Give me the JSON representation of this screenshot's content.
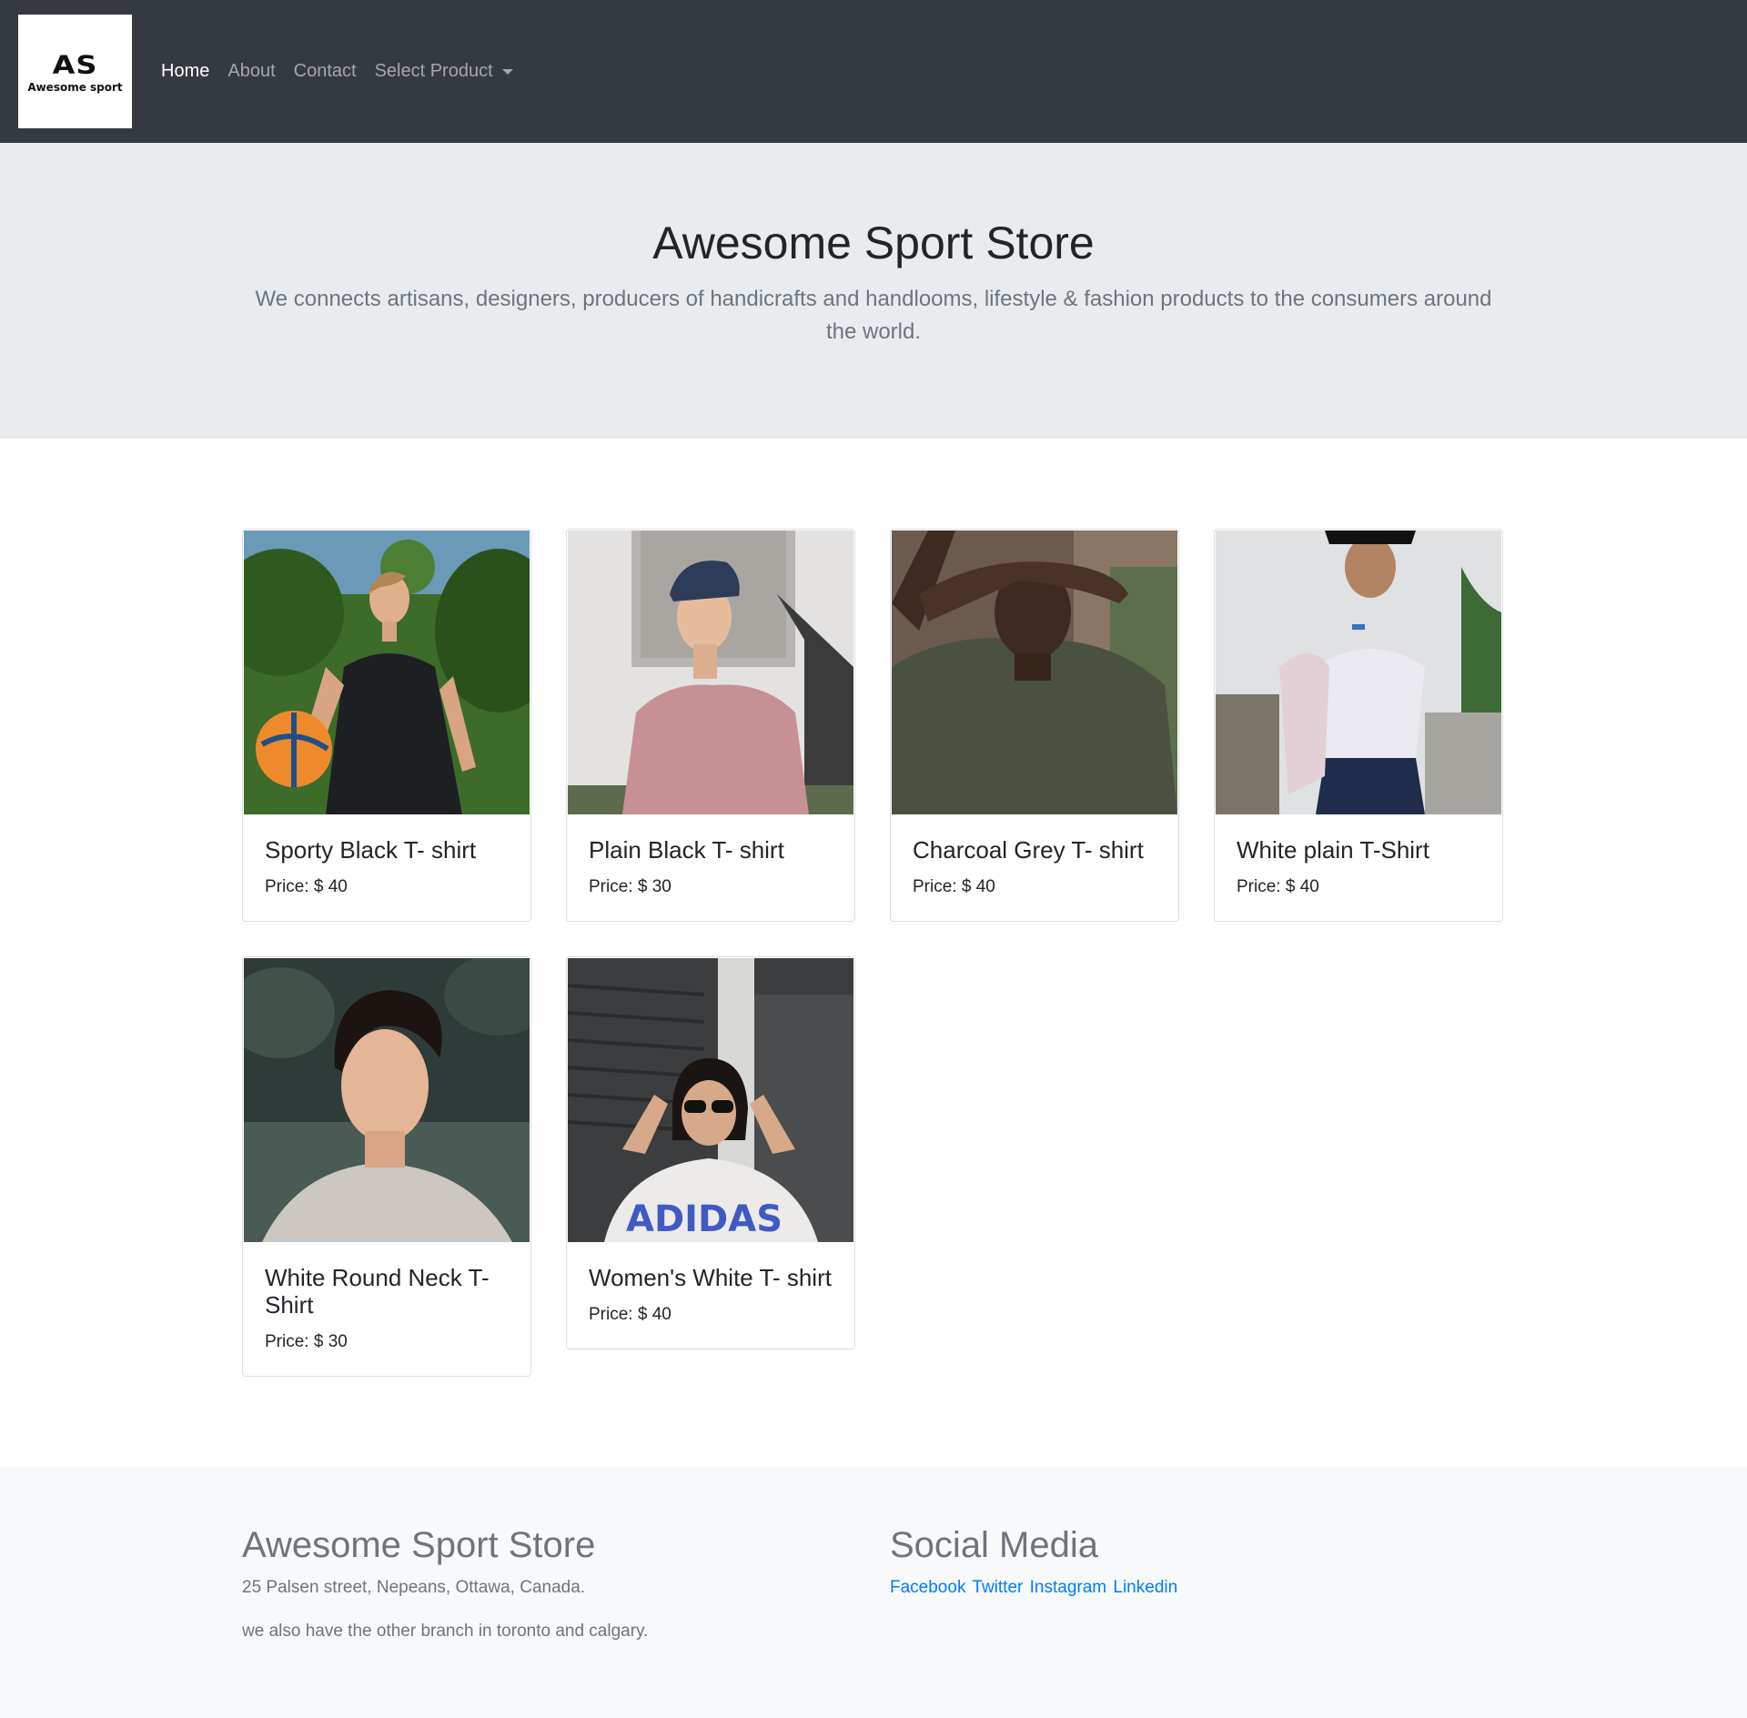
{
  "brand": {
    "mark": "AS",
    "name": "Awesome sport"
  },
  "nav": {
    "home": "Home",
    "about": "About",
    "contact": "Contact",
    "select_product": "Select Product"
  },
  "hero": {
    "title": "Awesome Sport Store",
    "lead": "We connects artisans, designers, producers of handicrafts and handlooms, lifestyle & fashion products to the consumers around the world."
  },
  "products": [
    {
      "title": "Sporty Black T- shirt",
      "price": "Price: $ 40"
    },
    {
      "title": "Plain Black T- shirt",
      "price": "Price: $ 30"
    },
    {
      "title": "Charcoal Grey T- shirt",
      "price": "Price: $ 40"
    },
    {
      "title": "White plain T-Shirt",
      "price": "Price: $ 40"
    },
    {
      "title": "White Round Neck T-Shirt",
      "price": "Price: $ 30"
    },
    {
      "title": "Women's White T- shirt",
      "price": "Price: $ 40"
    }
  ],
  "footer": {
    "store_title": "Awesome Sport Store",
    "address": "25 Palsen street, Nepeans, Ottawa, Canada.",
    "branch": "we also have the other branch in toronto and calgary.",
    "social_title": "Social Media",
    "social_links": [
      "Facebook",
      "Twitter",
      "Instagram",
      "Linkedin"
    ]
  },
  "colors": {
    "navbar": "#343a40",
    "jumbotron": "#e9ecef",
    "footer": "#f8f9fa",
    "link": "#007bff"
  }
}
